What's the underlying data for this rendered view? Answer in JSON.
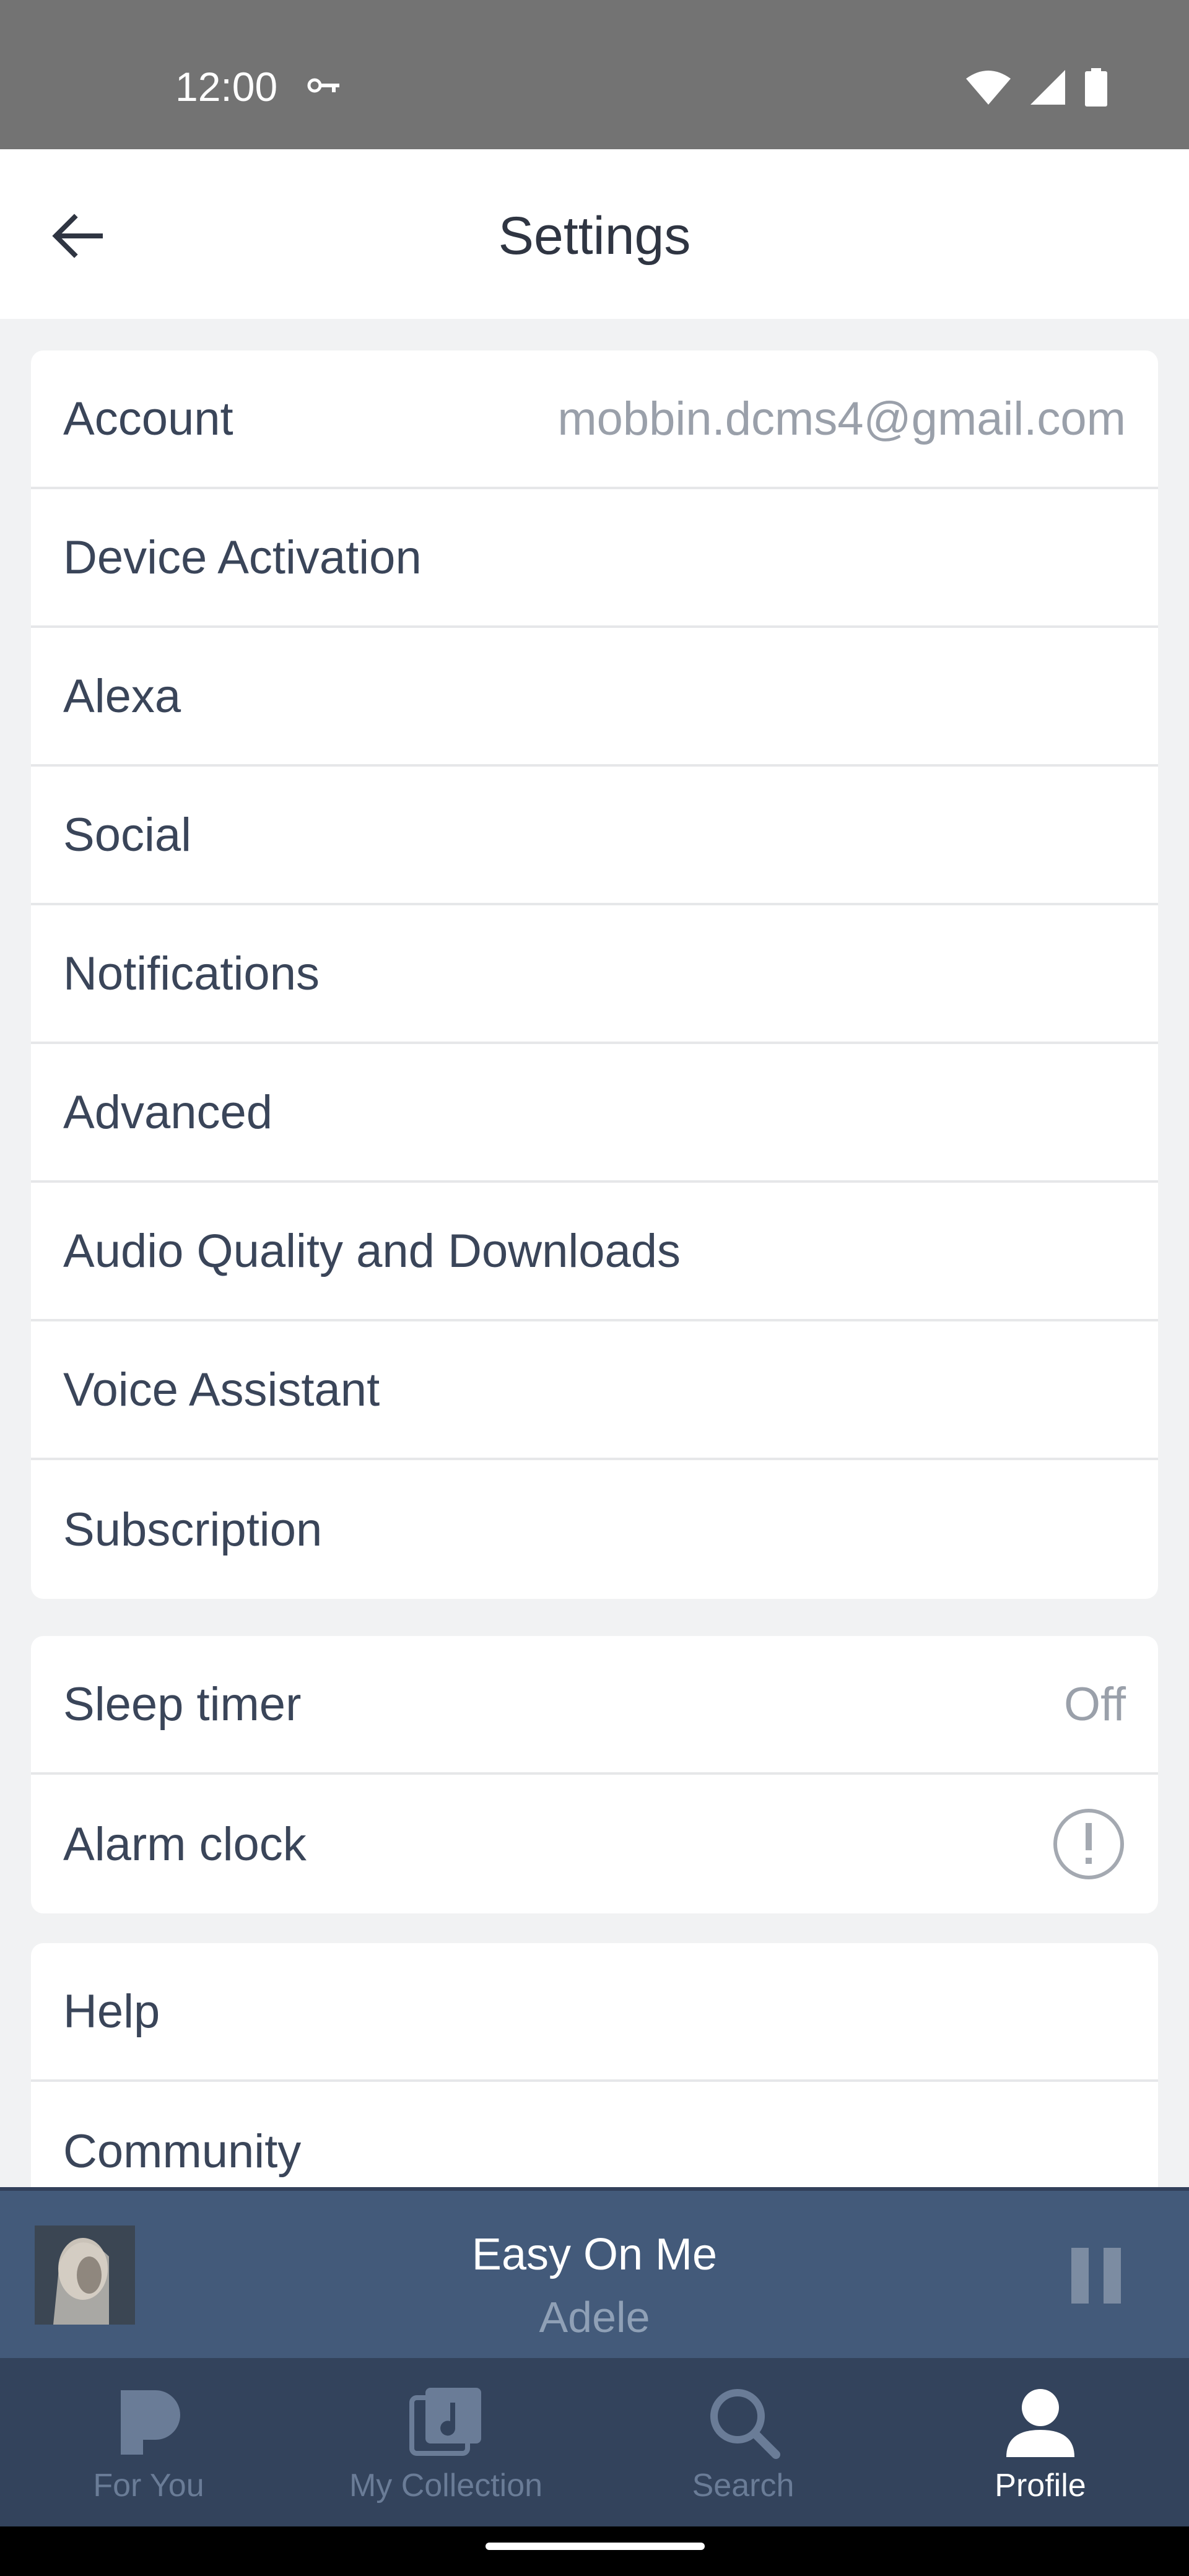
{
  "status_bar": {
    "time": "12:00"
  },
  "header": {
    "title": "Settings"
  },
  "sections": [
    {
      "items": [
        {
          "label": "Account",
          "value": "mobbin.dcms4@gmail.com"
        },
        {
          "label": "Device Activation"
        },
        {
          "label": "Alexa"
        },
        {
          "label": "Social"
        },
        {
          "label": "Notifications"
        },
        {
          "label": "Advanced"
        },
        {
          "label": "Audio Quality and Downloads"
        },
        {
          "label": "Voice Assistant"
        },
        {
          "label": "Subscription"
        }
      ]
    },
    {
      "items": [
        {
          "label": "Sleep timer",
          "value": "Off"
        },
        {
          "label": "Alarm clock",
          "icon": "alert-circle-icon"
        }
      ]
    },
    {
      "items": [
        {
          "label": "Help"
        },
        {
          "label": "Community"
        }
      ]
    }
  ],
  "player": {
    "title": "Easy On Me",
    "artist": "Adele"
  },
  "nav": {
    "items": [
      {
        "label": "For You",
        "icon": "pandora-p-icon"
      },
      {
        "label": "My Collection",
        "icon": "collection-icon"
      },
      {
        "label": "Search",
        "icon": "search-icon"
      },
      {
        "label": "Profile",
        "icon": "profile-icon",
        "active": true
      }
    ]
  }
}
